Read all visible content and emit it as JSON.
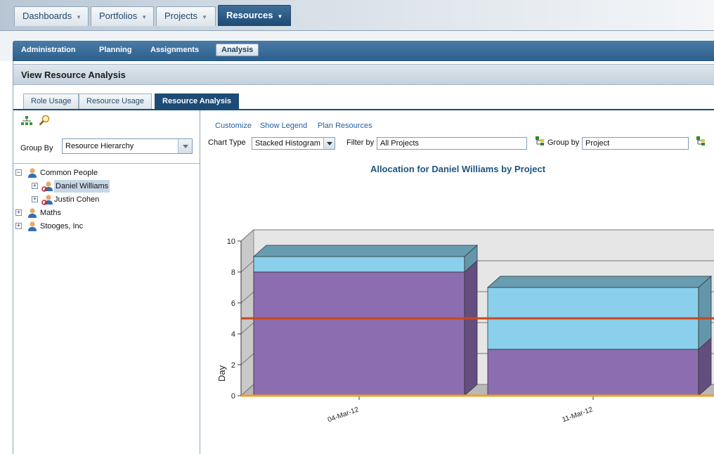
{
  "top_tabs": [
    {
      "label": "Dashboards",
      "active": false
    },
    {
      "label": "Portfolios",
      "active": false
    },
    {
      "label": "Projects",
      "active": false
    },
    {
      "label": "Resources",
      "active": true
    }
  ],
  "sub_nav": [
    {
      "label": "Administration",
      "active": false
    },
    {
      "label": "Planning",
      "active": false
    },
    {
      "label": "Assignments",
      "active": false
    },
    {
      "label": "Analysis",
      "active": true
    }
  ],
  "view_title": "View Resource Analysis",
  "inner_tabs": [
    {
      "label": "Role Usage",
      "active": false
    },
    {
      "label": "Resource Usage",
      "active": false
    },
    {
      "label": "Resource Analysis",
      "active": true
    }
  ],
  "left_panel": {
    "group_by_label": "Group By",
    "group_by_value": "Resource Hierarchy",
    "icons": [
      "hierarchy-icon",
      "search-icon"
    ],
    "tree": [
      {
        "label": "Common People",
        "expanded": true,
        "level": 0,
        "selected": false
      },
      {
        "label": "Daniel Williams",
        "expanded": false,
        "level": 1,
        "selected": true
      },
      {
        "label": "Justin Cohen",
        "expanded": false,
        "level": 1,
        "selected": false
      },
      {
        "label": "Maths",
        "expanded": false,
        "level": 0,
        "selected": false
      },
      {
        "label": "Stooges, Inc",
        "expanded": false,
        "level": 0,
        "selected": false
      }
    ]
  },
  "toolbar": {
    "customize": "Customize",
    "show_legend": "Show Legend",
    "plan_resources": "Plan Resources",
    "chart_type_label": "Chart Type",
    "chart_type_value": "Stacked Histogram",
    "filter_label": "Filter by",
    "filter_value": "All Projects",
    "group_label": "Group by",
    "group_value": "Project"
  },
  "chart_data": {
    "type": "bar",
    "stacked": true,
    "title": "Allocation for Daniel Williams by Project",
    "xlabel": "",
    "ylabel": "Day",
    "ylim": [
      0,
      10
    ],
    "yticks": [
      "0",
      "2",
      "4",
      "6",
      "8",
      "10"
    ],
    "categories": [
      "04-Mar-12",
      "11-Mar-12"
    ],
    "series": [
      {
        "color": "#8b6db0",
        "values": [
          8,
          3
        ]
      },
      {
        "color": "#8ad0ec",
        "values": [
          1,
          4
        ]
      }
    ],
    "reference_line": {
      "value": 5,
      "color": "#c8471f"
    },
    "grid": true,
    "legend": "none"
  }
}
